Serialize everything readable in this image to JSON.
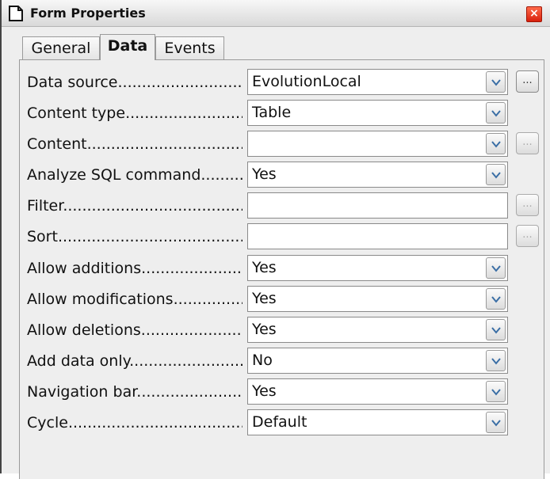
{
  "window": {
    "title": "Form Properties",
    "close_label": "×"
  },
  "tabs": [
    {
      "label": "General"
    },
    {
      "label": "Data",
      "active": true
    },
    {
      "label": "Events"
    }
  ],
  "rows": [
    {
      "label": "Data source",
      "value": "EvolutionLocal"
    },
    {
      "label": "Content type",
      "value": "Table"
    },
    {
      "label": "Content",
      "value": ""
    },
    {
      "label": "Analyze SQL command",
      "value": "Yes"
    },
    {
      "label": "Filter",
      "value": ""
    },
    {
      "label": "Sort",
      "value": ""
    },
    {
      "label": "Allow additions",
      "value": "Yes"
    },
    {
      "label": "Allow modifications",
      "value": "Yes"
    },
    {
      "label": "Allow deletions",
      "value": "Yes"
    },
    {
      "label": "Add data only",
      "value": "No"
    },
    {
      "label": "Navigation bar",
      "value": "Yes"
    },
    {
      "label": "Cycle",
      "value": "Default"
    }
  ],
  "ellipsis_label": "...",
  "colors": {
    "close_button": "#d8200c",
    "field_bg": "#ffffff",
    "dialog_bg": "#eeeeee"
  }
}
